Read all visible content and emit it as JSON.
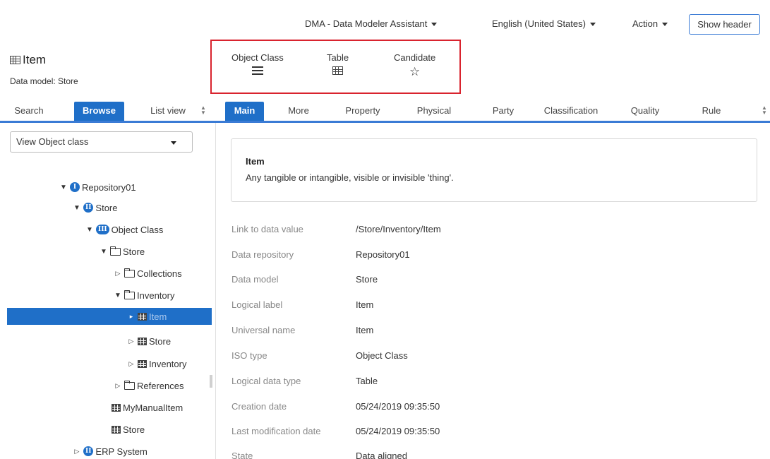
{
  "topbar": {
    "app_menu": "DMA - Data Modeler Assistant",
    "language_menu": "English (United States)",
    "action_menu": "Action",
    "show_header": "Show header"
  },
  "item": {
    "title": "Item",
    "model_line": "Data model: Store"
  },
  "view_types": [
    {
      "label": "Object Class",
      "icon": "list-icon"
    },
    {
      "label": "Table",
      "icon": "table-icon"
    },
    {
      "label": "Candidate",
      "icon": "star-outline-icon"
    }
  ],
  "left_tabs": {
    "search": "Search",
    "browse": "Browse",
    "list_view": "List view"
  },
  "main_tabs": [
    "Main",
    "More",
    "Property",
    "Physical",
    "Party",
    "Classification",
    "Quality",
    "Rule"
  ],
  "view_select": {
    "selected": "View Object class"
  },
  "tree": [
    {
      "label": "Repository01",
      "icon": "badge",
      "badge": "I"
    },
    {
      "label": "Store",
      "icon": "badge",
      "badge": "II"
    },
    {
      "label": "Object Class",
      "icon": "badge",
      "badge": "III"
    },
    {
      "label": "Store",
      "icon": "folder-icon"
    },
    {
      "label": "Collections",
      "icon": "folder-icon"
    },
    {
      "label": "Inventory",
      "icon": "folder-icon"
    },
    {
      "label": "Item",
      "icon": "table-icon",
      "selected": true
    },
    {
      "label": "Store",
      "icon": "table-icon"
    },
    {
      "label": "Inventory",
      "icon": "table-icon"
    },
    {
      "label": "References",
      "icon": "folder-icon"
    },
    {
      "label": "MyManualItem",
      "icon": "table-icon"
    },
    {
      "label": "Store",
      "icon": "table-icon"
    },
    {
      "label": "ERP System",
      "icon": "badge",
      "badge": "II"
    }
  ],
  "description": {
    "title": "Item",
    "text": "Any tangible or intangible, visible or invisible 'thing'."
  },
  "properties": [
    {
      "label": "Link to data value",
      "value": "/Store/Inventory/Item"
    },
    {
      "label": "Data repository",
      "value": "Repository01"
    },
    {
      "label": "Data model",
      "value": "Store"
    },
    {
      "label": "Logical label",
      "value": "Item"
    },
    {
      "label": "Universal name",
      "value": "Item"
    },
    {
      "label": "ISO type",
      "value": "Object Class"
    },
    {
      "label": "Logical data type",
      "value": "Table"
    },
    {
      "label": "Creation date",
      "value": "05/24/2019 09:35:50"
    },
    {
      "label": "Last modification date",
      "value": "05/24/2019 09:35:50"
    },
    {
      "label": "State",
      "value": "Data aligned"
    }
  ],
  "colors": {
    "accent": "#1f6fc8",
    "highlight_box": "#d9232e"
  }
}
